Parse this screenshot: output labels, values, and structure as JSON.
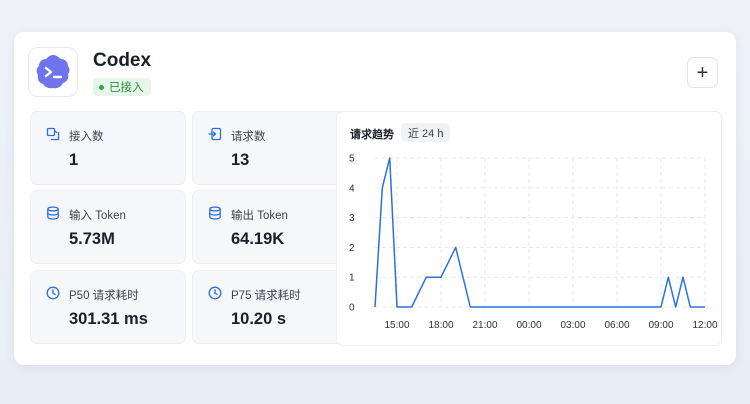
{
  "header": {
    "title": "Codex",
    "status": "已接入",
    "add_label": "+"
  },
  "stats": [
    {
      "label": "接入数",
      "value": "1",
      "icon": "link-icon"
    },
    {
      "label": "请求数",
      "value": "13",
      "icon": "request-icon"
    },
    {
      "label": "输入 Token",
      "value": "5.73M",
      "icon": "database-icon"
    },
    {
      "label": "输出 Token",
      "value": "64.19K",
      "icon": "database-icon"
    },
    {
      "label": "P50 请求耗时",
      "value": "301.31 ms",
      "icon": "clock-icon"
    },
    {
      "label": "P75 请求耗时",
      "value": "10.20 s",
      "icon": "clock-icon"
    }
  ],
  "chart": {
    "title": "请求趋势",
    "range_chip": "近 24 h"
  },
  "colors": {
    "accent": "#2b6fe0",
    "logo": "#6f74ec",
    "badge_bg": "#e7f6ea",
    "badge_text": "#2f8a45"
  },
  "chart_data": {
    "type": "line",
    "title": "请求趋势",
    "x_ticks": [
      "15:00",
      "18:00",
      "21:00",
      "00:00",
      "03:00",
      "06:00",
      "09:00",
      "12:00"
    ],
    "y_ticks": [
      "0",
      "1",
      "2",
      "3",
      "4",
      "5"
    ],
    "ylim": [
      0,
      5
    ],
    "grid": true,
    "x_hours": [
      13.5,
      14,
      14.5,
      15,
      16,
      17,
      18,
      19,
      20,
      21,
      22,
      23,
      24,
      25,
      26,
      27,
      28,
      29,
      30,
      31,
      32,
      33,
      33.5,
      34,
      34.5,
      35,
      35.5,
      36
    ],
    "values": [
      0,
      4,
      5,
      0,
      0,
      1,
      1,
      2,
      0,
      0,
      0,
      0,
      0,
      0,
      0,
      0,
      0,
      0,
      0,
      0,
      0,
      0,
      1,
      0,
      1,
      0,
      0,
      0
    ]
  }
}
